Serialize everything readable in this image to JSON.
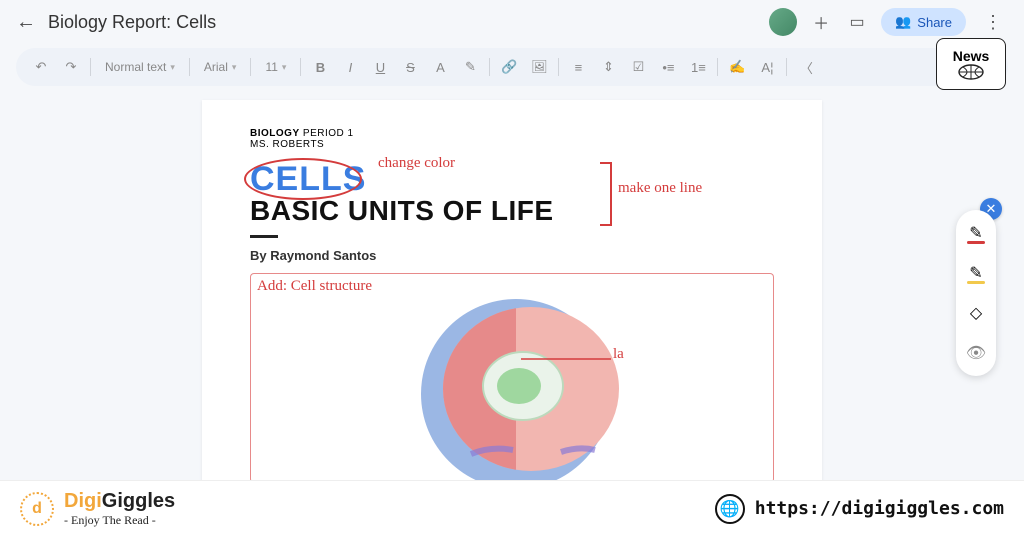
{
  "header": {
    "doc_title": "Biology Report: Cells",
    "share_label": "Share"
  },
  "toolbar": {
    "style_select": "Normal text",
    "font_select": "Arial",
    "font_size": "11"
  },
  "doc": {
    "course_line_bold": "BIOLOGY",
    "course_line_rest": " PERIOD 1",
    "teacher_line": "MS. ROBERTS",
    "title_line1": "CELLS",
    "title_line2": "BASIC UNITS OF LIFE",
    "byline": "By Raymond Santos"
  },
  "annotations": {
    "change_color": "change color",
    "make_one_line": "make one line",
    "add_structure": "Add: Cell structure",
    "label_la": "la"
  },
  "news_badge": "News",
  "footer": {
    "brand_a": "Digi",
    "brand_b": "Giggles",
    "tagline": "- Enjoy The Read -",
    "url": "https://digigiggles.com"
  }
}
